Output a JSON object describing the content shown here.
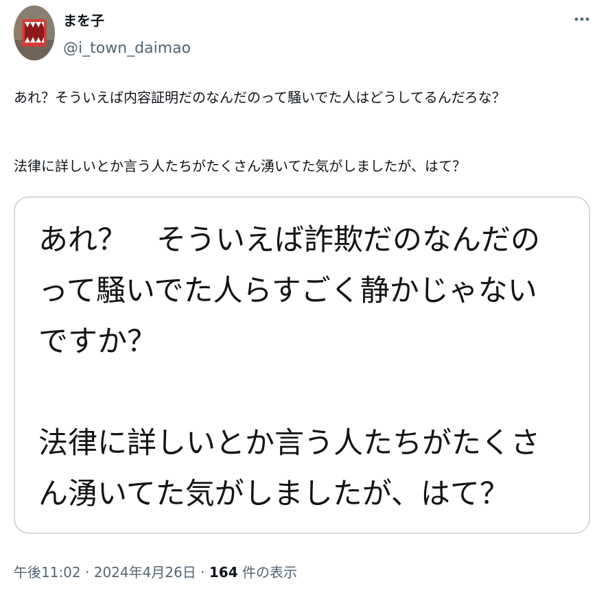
{
  "user": {
    "display_name": "まを子",
    "handle": "@i_town_daimao"
  },
  "tweet": {
    "text_lines": [
      "あれ？そういえば内容証明だのなんだのって騒いでた人はどうしてるんだろな？",
      "法律に詳しいとか言う人たちがたくさん湧いてた気がしましたが、はて？"
    ]
  },
  "media": {
    "lines": [
      "あれ？　そういえば詐欺だのなんだの",
      "って騒いでた人らすごく静かじゃない",
      "ですか？",
      "法律に詳しいとか言う人たちがたくさ",
      "ん湧いてた気がしましたが、はて？"
    ]
  },
  "meta": {
    "time": "午後11:02",
    "separator": " · ",
    "date": "2024年4月26日",
    "views_count": "164",
    "views_label": " 件の表示"
  },
  "icons": {
    "more": "more-horizontal-icon",
    "avatar": "avatar-image"
  },
  "colors": {
    "text": "#0f1419",
    "secondary": "#536471",
    "border": "#cfd9de"
  }
}
